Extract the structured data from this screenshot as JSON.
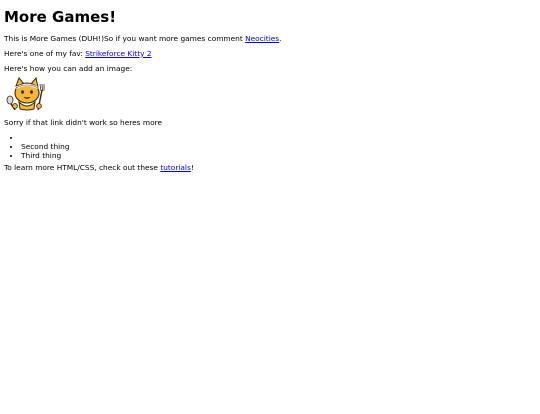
{
  "page": {
    "title": "More Games!",
    "intro": {
      "text": "This is More Games (DUH!)So if you want more games comment ",
      "link_text": "Neocities",
      "suffix": "."
    },
    "fav": {
      "text": "Here's one of my fav: ",
      "link_text": "Strikeforce Kitty 2"
    },
    "image_intro": "Here's how you can add an image:",
    "image": {
      "icon": "cat-mascot-icon",
      "colors": {
        "fur": "#f5b73b",
        "outline": "#3a2a12"
      }
    },
    "sorry": "Sorry if that link didn't work so heres more",
    "list": [
      "",
      "Second thing",
      "Third thing"
    ],
    "learn": {
      "text": "To learn more HTML/CSS, check out these ",
      "link_text": "tutorials",
      "suffix": "!"
    }
  }
}
